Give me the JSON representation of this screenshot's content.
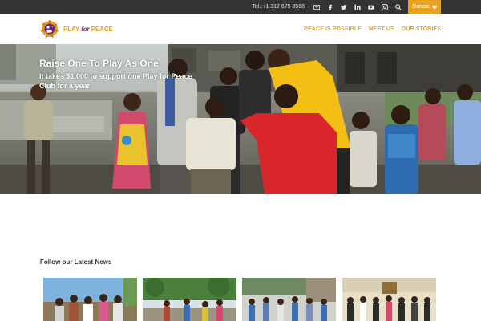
{
  "topbar": {
    "phone": "Tel.:+1 312 675 8568",
    "icons": [
      "mail-icon",
      "facebook-icon",
      "twitter-icon",
      "linkedin-icon",
      "youtube-icon",
      "instagram-icon",
      "search-icon"
    ],
    "donate_label": "Donate"
  },
  "header": {
    "logo": {
      "play": "PLAY",
      "for": "for",
      "peace": "PEACE"
    },
    "nav": [
      "PEACE IS POSSIBLE",
      "MEET US",
      "OUR STORIES"
    ]
  },
  "hero": {
    "title": "Raise One To Play As One",
    "subtitle": "It takes $1,000 to support one Play for Peace Club for a year"
  },
  "news": {
    "heading": "Follow our Latest News"
  },
  "colors": {
    "accent": "#e8a21d",
    "topbar": "#333333",
    "logo_purple": "#6a2c7a"
  }
}
